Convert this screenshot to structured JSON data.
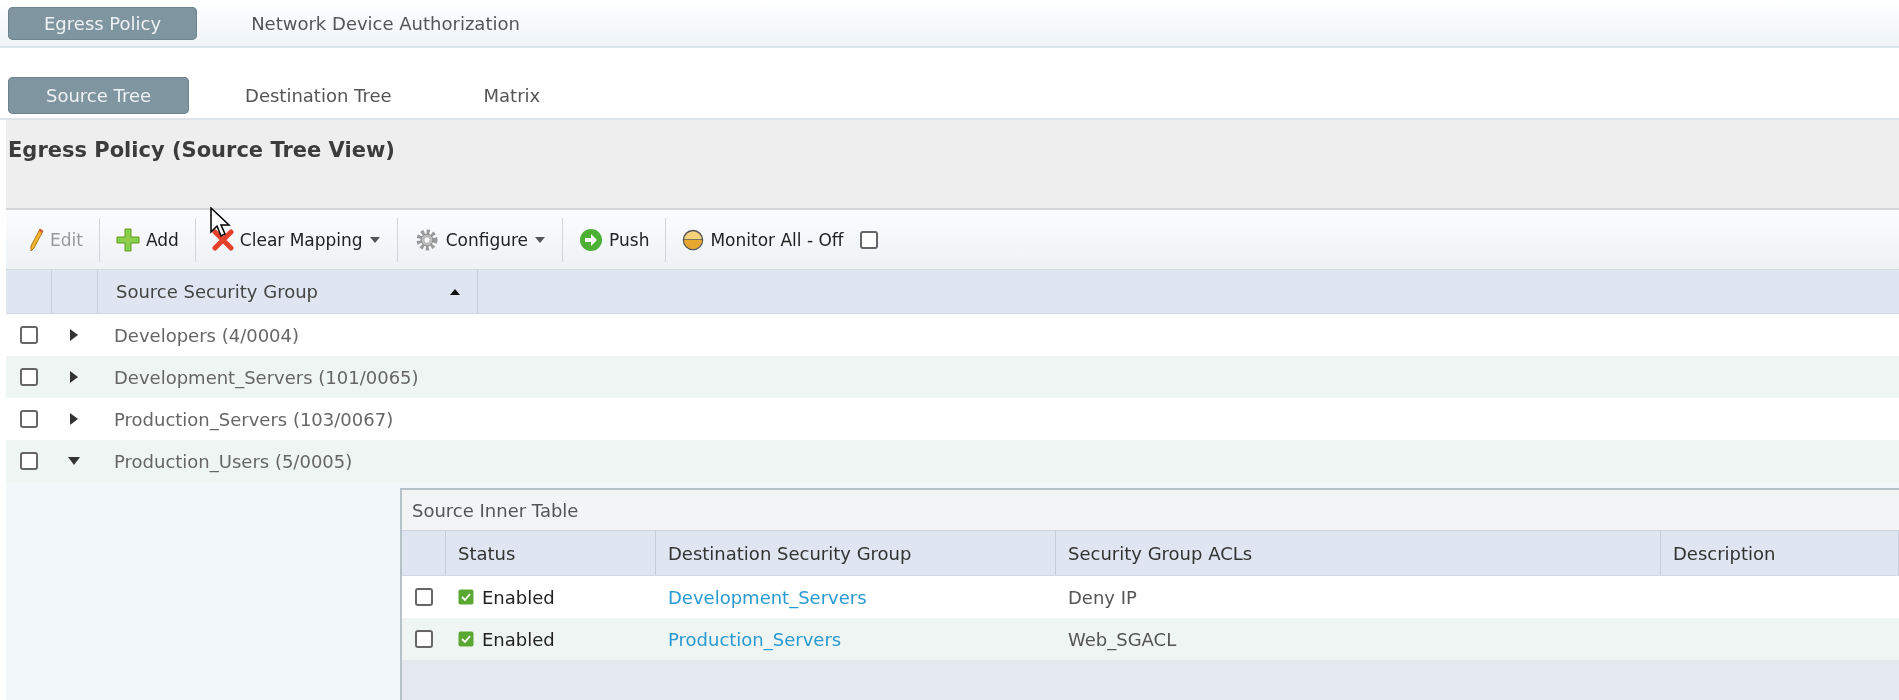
{
  "top_tabs": [
    {
      "label": "Egress Policy",
      "selected": true
    },
    {
      "label": "Network Device Authorization",
      "selected": false
    }
  ],
  "view_tabs": [
    {
      "label": "Source Tree",
      "selected": true
    },
    {
      "label": "Destination Tree",
      "selected": false
    },
    {
      "label": "Matrix",
      "selected": false
    }
  ],
  "section_title": "Egress Policy (Source Tree View)",
  "toolbar": [
    {
      "kind": "edit",
      "label": "Edit",
      "disabled": true,
      "dropdown": false
    },
    {
      "kind": "add",
      "label": "Add",
      "disabled": false,
      "dropdown": false
    },
    {
      "kind": "clear",
      "label": "Clear Mapping",
      "disabled": false,
      "dropdown": true
    },
    {
      "kind": "configure",
      "label": "Configure",
      "disabled": false,
      "dropdown": true
    },
    {
      "kind": "push",
      "label": "Push",
      "disabled": false,
      "dropdown": false
    },
    {
      "kind": "monitor",
      "label": "Monitor All - Off",
      "disabled": false,
      "dropdown": false,
      "checked": false
    }
  ],
  "table": {
    "columns": [
      "Source Security Group"
    ],
    "rows": [
      {
        "label": "Developers (4/0004)",
        "checked": false,
        "expanded": false
      },
      {
        "label": "Development_Servers (101/0065)",
        "checked": false,
        "expanded": false
      },
      {
        "label": "Production_Servers (103/0067)",
        "checked": false,
        "expanded": false
      },
      {
        "label": "Production_Users (5/0005)",
        "checked": false,
        "expanded": true
      }
    ]
  },
  "inner_table": {
    "title": "Source Inner Table",
    "columns": [
      "Status",
      "Destination Security Group",
      "Security Group ACLs",
      "Description"
    ],
    "rows": [
      {
        "checked": false,
        "enabled": true,
        "status": "Enabled",
        "destination": "Development_Servers",
        "acls": "Deny IP"
      },
      {
        "checked": false,
        "enabled": true,
        "status": "Enabled",
        "destination": "Production_Servers",
        "acls": "Web_SGACL"
      }
    ]
  }
}
